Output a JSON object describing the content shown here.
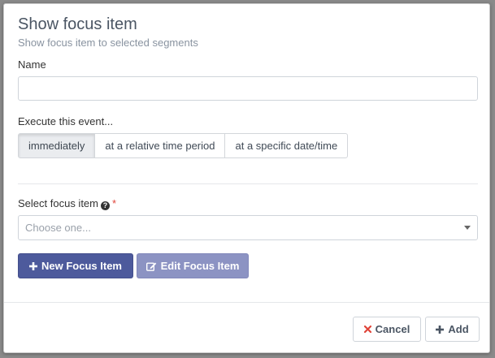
{
  "modal": {
    "title": "Show focus item",
    "subtitle": "Show focus item to selected segments"
  },
  "name_field": {
    "label": "Name",
    "value": "",
    "placeholder": ""
  },
  "execute": {
    "label": "Execute this event...",
    "options": [
      "immediately",
      "at a relative time period",
      "at a specific date/time"
    ],
    "selected": "immediately"
  },
  "focus_select": {
    "label": "Select focus item",
    "required_mark": "*",
    "help_icon": "question-circle-icon",
    "placeholder": "Choose one..."
  },
  "buttons": {
    "new_focus_item": "New Focus Item",
    "edit_focus_item": "Edit Focus Item",
    "cancel": "Cancel",
    "add": "Add"
  },
  "colors": {
    "primary": "#4d5a9c",
    "secondary": "#8c93c3",
    "danger": "#e0453a"
  }
}
